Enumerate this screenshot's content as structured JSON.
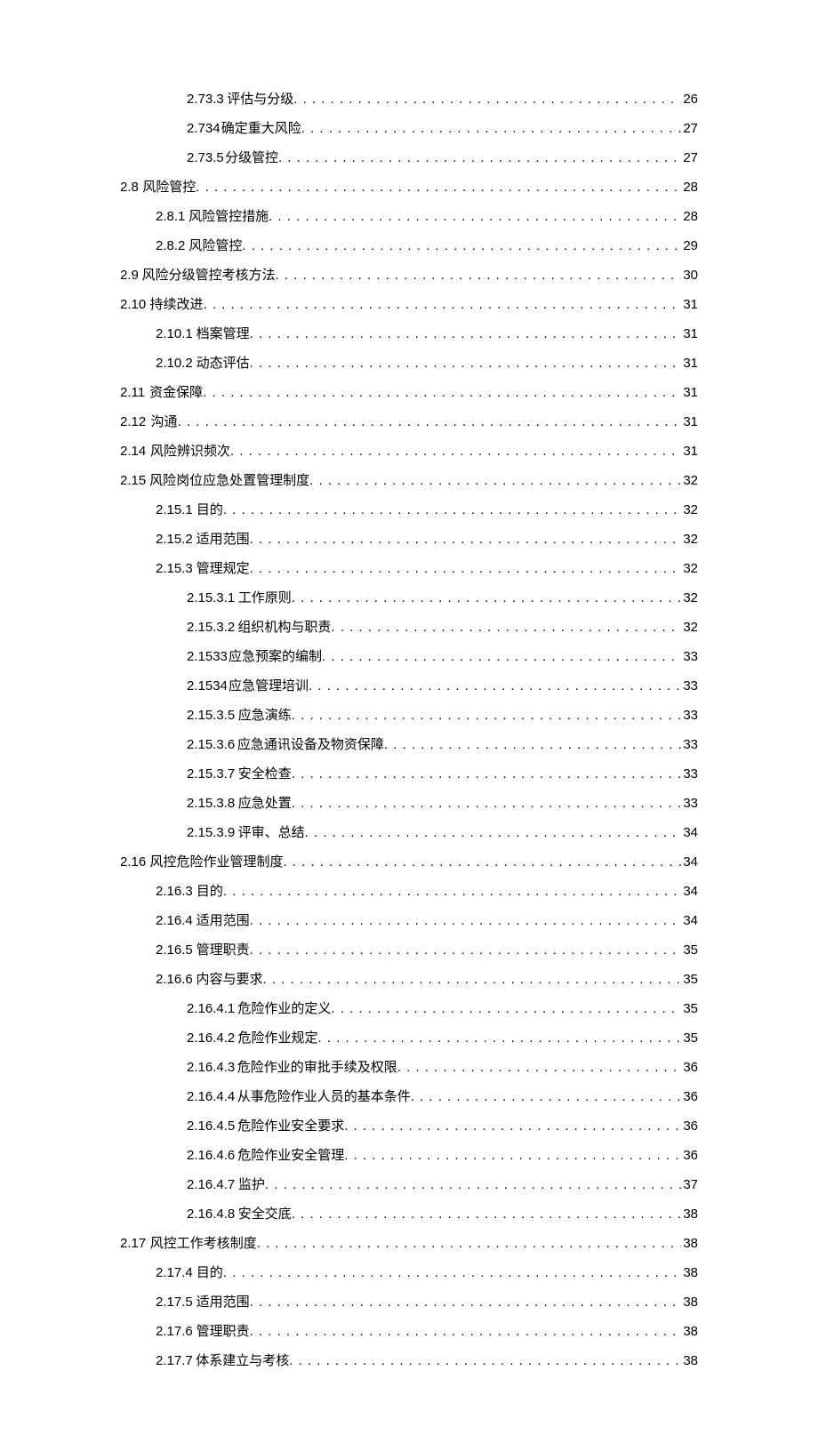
{
  "entries": [
    {
      "indent": 75,
      "num": "2.73.3",
      "ngap": 12,
      "title": "评估与分级",
      "page": "26"
    },
    {
      "indent": 75,
      "num": "2.734",
      "ngap": 4,
      "title": "确定重大风险",
      "page": "27"
    },
    {
      "indent": 75,
      "num": "2.73.5",
      "ngap": 4,
      "title": "分级管控",
      "page": "27"
    },
    {
      "indent": 0,
      "num": "2.8",
      "ngap": 12,
      "title": "风险管控",
      "page": "28"
    },
    {
      "indent": 40,
      "num": "2.8.1",
      "ngap": 12,
      "title": "风险管控措施",
      "page": "28"
    },
    {
      "indent": 40,
      "num": "2.8.2",
      "ngap": 12,
      "title": "风险管控",
      "page": "29"
    },
    {
      "indent": 0,
      "num": "2.9",
      "ngap": 12,
      "title": "风险分级管控考核方法",
      "page": "30"
    },
    {
      "indent": 0,
      "num": "2.10",
      "ngap": 12,
      "title": "持续改进",
      "page": "31"
    },
    {
      "indent": 40,
      "num": "2.10.1",
      "ngap": 12,
      "title": "档案管理",
      "page": "31"
    },
    {
      "indent": 40,
      "num": "2.10.2",
      "ngap": 12,
      "title": "动态评估",
      "page": "31"
    },
    {
      "indent": 0,
      "num": "2.11",
      "ngap": 14,
      "title": "资金保障",
      "page": "31"
    },
    {
      "indent": 0,
      "num": "2.12",
      "ngap": 14,
      "title": "沟通",
      "page": "31"
    },
    {
      "indent": 0,
      "num": "2.14",
      "ngap": 14,
      "title": "风险辨识频次",
      "page": "31"
    },
    {
      "indent": 0,
      "num": "2.15",
      "ngap": 14,
      "title": "风险岗位应急处置管理制度",
      "page": "32"
    },
    {
      "indent": 40,
      "num": "2.15.1",
      "ngap": 12,
      "title": "目的",
      "page": "32"
    },
    {
      "indent": 40,
      "num": "2.15.2",
      "ngap": 12,
      "title": "适用范围",
      "page": "32"
    },
    {
      "indent": 40,
      "num": "2.15.3",
      "ngap": 12,
      "title": "管理规定",
      "page": "32"
    },
    {
      "indent": 75,
      "num": "2.15.3.1",
      "ngap": 12,
      "title": "工作原则",
      "page": "32"
    },
    {
      "indent": 75,
      "num": "2.15.3.2",
      "ngap": 12,
      "title": "组织机构与职责",
      "page": "32"
    },
    {
      "indent": 75,
      "num": "2.1533",
      "ngap": 4,
      "title": "应急预案的编制",
      "page": "33"
    },
    {
      "indent": 75,
      "num": "2.1534",
      "ngap": 4,
      "title": "应急管理培训",
      "page": "33"
    },
    {
      "indent": 75,
      "num": "2.15.3.5",
      "ngap": 12,
      "title": "应急演练",
      "page": "33"
    },
    {
      "indent": 75,
      "num": "2.15.3.6",
      "ngap": 12,
      "title": "应急通讯设备及物资保障",
      "page": "33"
    },
    {
      "indent": 75,
      "num": "2.15.3.7",
      "ngap": 12,
      "title": "安全检查",
      "page": "33"
    },
    {
      "indent": 75,
      "num": "2.15.3.8",
      "ngap": 12,
      "title": "应急处置",
      "page": "33"
    },
    {
      "indent": 75,
      "num": "2.15.3.9",
      "ngap": 12,
      "title": "评审、总结",
      "page": "34"
    },
    {
      "indent": 0,
      "num": "2.16",
      "ngap": 14,
      "title": "风控危险作业管理制度",
      "page": "34"
    },
    {
      "indent": 40,
      "num": "2.16.3",
      "ngap": 12,
      "title": "目的",
      "page": "34"
    },
    {
      "indent": 40,
      "num": "2.16.4",
      "ngap": 12,
      "title": "适用范围",
      "page": "34"
    },
    {
      "indent": 40,
      "num": "2.16.5",
      "ngap": 12,
      "title": "管理职责",
      "page": "35"
    },
    {
      "indent": 40,
      "num": "2.16.6",
      "ngap": 12,
      "title": "内容与要求",
      "page": "35"
    },
    {
      "indent": 75,
      "num": "2.16.4.1",
      "ngap": 12,
      "title": "危险作业的定义",
      "page": "35"
    },
    {
      "indent": 75,
      "num": "2.16.4.2",
      "ngap": 12,
      "title": "危险作业规定",
      "page": "35"
    },
    {
      "indent": 75,
      "num": "2.16.4.3",
      "ngap": 12,
      "title": "危险作业的审批手续及权限",
      "page": "36"
    },
    {
      "indent": 75,
      "num": "2.16.4.4",
      "ngap": 12,
      "title": "从事危险作业人员的基本条件",
      "page": "36"
    },
    {
      "indent": 75,
      "num": "2.16.4.5",
      "ngap": 12,
      "title": "危险作业安全要求",
      "page": "36"
    },
    {
      "indent": 75,
      "num": "2.16.4.6",
      "ngap": 12,
      "title": "危险作业安全管理",
      "page": "36"
    },
    {
      "indent": 75,
      "num": "2.16.4.7",
      "ngap": 12,
      "title": "监护",
      "page": "37"
    },
    {
      "indent": 75,
      "num": "2.16.4.8",
      "ngap": 12,
      "title": "安全交底",
      "page": "38"
    },
    {
      "indent": 0,
      "num": "2.17",
      "ngap": 14,
      "title": "风控工作考核制度",
      "page": "38"
    },
    {
      "indent": 40,
      "num": "2.17.4",
      "ngap": 12,
      "title": "目的",
      "page": "38"
    },
    {
      "indent": 40,
      "num": "2.17.5",
      "ngap": 12,
      "title": "适用范围",
      "page": "38"
    },
    {
      "indent": 40,
      "num": "2.17.6",
      "ngap": 12,
      "title": "管理职责",
      "page": "38"
    },
    {
      "indent": 40,
      "num": "2.17.7",
      "ngap": 12,
      "title": "体系建立与考核",
      "page": "38"
    }
  ]
}
